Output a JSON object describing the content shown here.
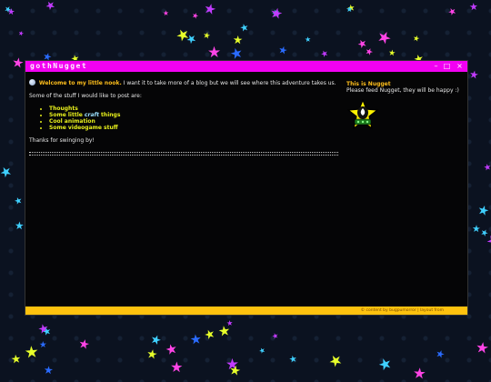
{
  "window": {
    "title": "gothNugget",
    "minimize_label": "–",
    "maximize_label": "□",
    "close_label": "×"
  },
  "main": {
    "welcome_title": "Welcome to my little nook.",
    "intro_text": "I want it to take more of a blog but we will see where this adventure takes us.",
    "stuff_intro": "Some of the stuff I would like to post are:",
    "list": [
      {
        "text": "Thoughts"
      },
      {
        "pre": "Some little ",
        "em": "craft",
        "post": " things"
      },
      {
        "text": "Cool animation"
      },
      {
        "text": "Some videogame stuff"
      }
    ],
    "thanks": "Thanks for swinging by!"
  },
  "sidebar": {
    "title": "This is Nugget",
    "caption": "Please feed Nugget, they will be happy :)"
  },
  "footer": {
    "text": "© content by bugpumorror | layout from"
  },
  "colors": {
    "titlebar": "#f200f2",
    "accent": "#ffbf1c",
    "list": "#e8f01c",
    "footer": "#ffc20e"
  }
}
